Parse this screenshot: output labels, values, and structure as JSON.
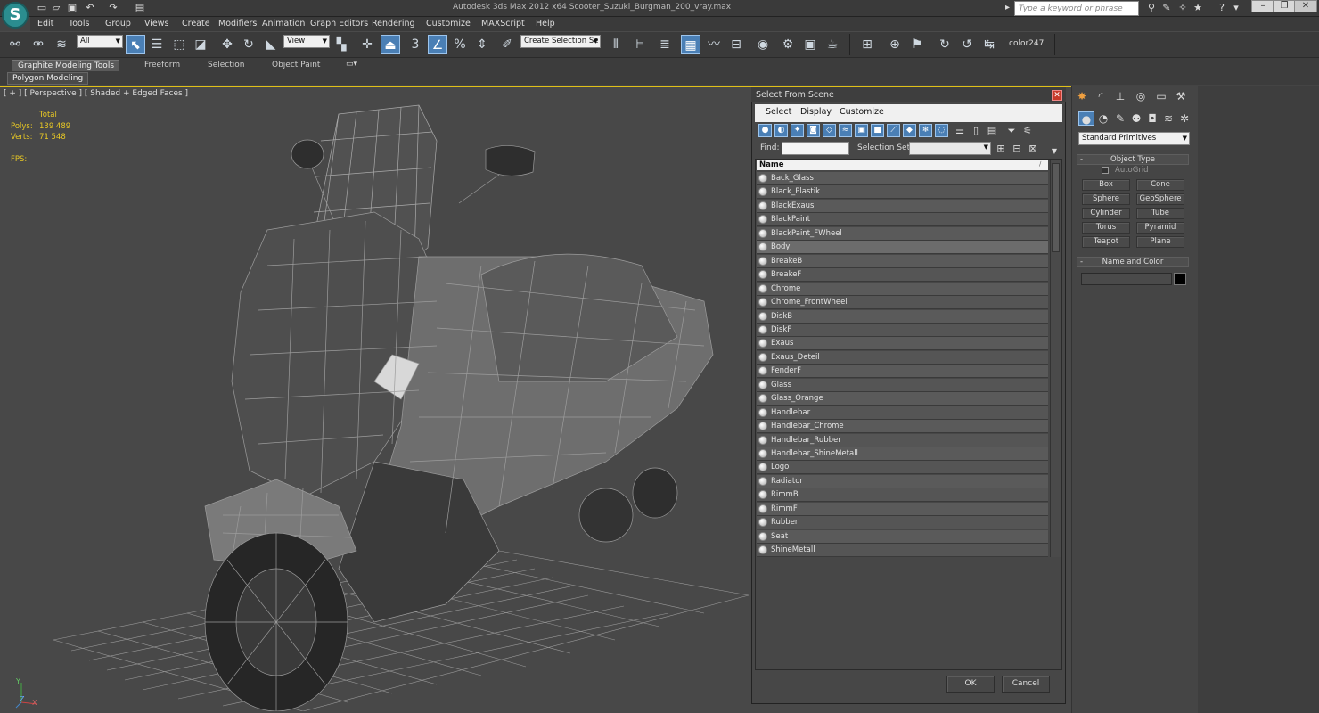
{
  "app": {
    "window_title": "Autodesk 3ds Max  2012 x64    Scooter_Suzuki_Burgman_200_vray.max",
    "logo_letter": "S",
    "search_placeholder": "Type a keyword or phrase"
  },
  "menubar": [
    "Edit",
    "Tools",
    "Group",
    "Views",
    "Create",
    "Modifiers",
    "Animation",
    "Graph Editors",
    "Rendering",
    "Customize",
    "MAXScript",
    "Help"
  ],
  "toolbar": {
    "filter_value": "All",
    "refcoord_value": "View",
    "named_selection_placeholder": "Create Selection Se",
    "snap_label": "3",
    "angle_snap_label": "%",
    "layer_label": "color247"
  },
  "ribbon": {
    "tabs": [
      "Graphite Modeling Tools",
      "Freeform",
      "Selection",
      "Object Paint"
    ],
    "subtab": "Polygon Modeling"
  },
  "viewport": {
    "label": "[ + ] [ Perspective ] [ Shaded + Edged Faces ]",
    "stats": {
      "total_label": "Total",
      "polys_label": "Polys:",
      "polys_value": "139 489",
      "verts_label": "Verts:",
      "verts_value": "71 548",
      "fps_label": "FPS:"
    },
    "axis_labels": [
      "Y",
      "X",
      "Z"
    ]
  },
  "dialog": {
    "title": "Select From Scene",
    "menu": [
      "Select",
      "Display",
      "Customize"
    ],
    "find_label": "Find:",
    "find_value": "",
    "selection_set_label": "Selection Set:",
    "column_header": "Name",
    "selected_item": "Body",
    "items": [
      "Back_Glass",
      "Black_Plastik",
      "BlackExaus",
      "BlackPaint",
      "BlackPaint_FWheel",
      "Body",
      "BreakeB",
      "BreakeF",
      "Chrome",
      "Chrome_FrontWheel",
      "DiskB",
      "DiskF",
      "Exaus",
      "Exaus_Deteil",
      "FenderF",
      "Glass",
      "Glass_Orange",
      "Handlebar",
      "Handlebar_Chrome",
      "Handlebar_Rubber",
      "Handlebar_ShineMetall",
      "Logo",
      "Radiator",
      "RimmB",
      "RimmF",
      "Rubber",
      "Seat",
      "ShineMetall"
    ],
    "ok_label": "OK",
    "cancel_label": "Cancel"
  },
  "command_panel": {
    "category_value": "Standard Primitives",
    "object_type_title": "Object Type",
    "autogrid_label": "AutoGrid",
    "primitives": [
      "Box",
      "Cone",
      "Sphere",
      "GeoSphere",
      "Cylinder",
      "Tube",
      "Torus",
      "Pyramid",
      "Teapot",
      "Plane"
    ],
    "name_color_title": "Name and Color",
    "name_value": "",
    "object_color": "#000000"
  },
  "colors": {
    "accent": "#4a7fb5",
    "viewport_border": "#e0c018",
    "stats_text": "#e8c824",
    "close_button": "#c73a2a"
  }
}
